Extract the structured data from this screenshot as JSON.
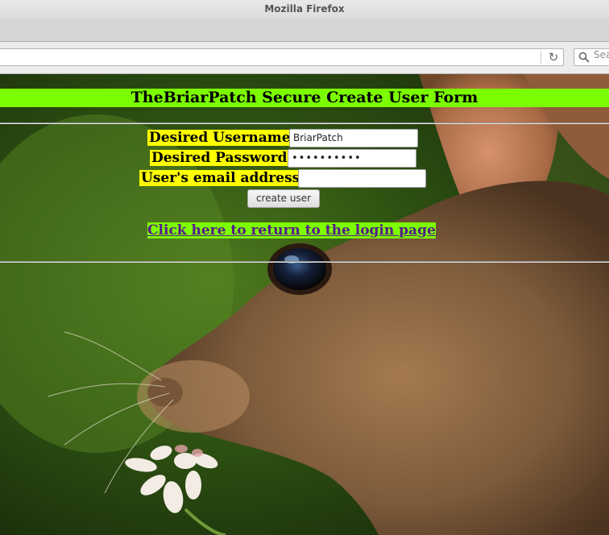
{
  "window": {
    "title": "Mozilla Firefox"
  },
  "toolbar": {
    "url": "",
    "search_placeholder": "Search"
  },
  "page": {
    "heading": "TheBriarPatch Secure Create User Form",
    "form": {
      "username_label": "Desired Username:",
      "username_value": "BriarPatch",
      "password_label": "Desired Password:",
      "password_value": "••••••••••",
      "email_label": "User's email address:",
      "email_value": "",
      "submit_label": "create user"
    },
    "login_link": "Click here to return to the login page"
  },
  "colors": {
    "heading_bg": "#7cfc00",
    "label_bg": "#ffff00",
    "link_color": "#551a8b"
  },
  "background_image": "photo of a wild rabbit holding a clover flower in its mouth against a green blurred background"
}
